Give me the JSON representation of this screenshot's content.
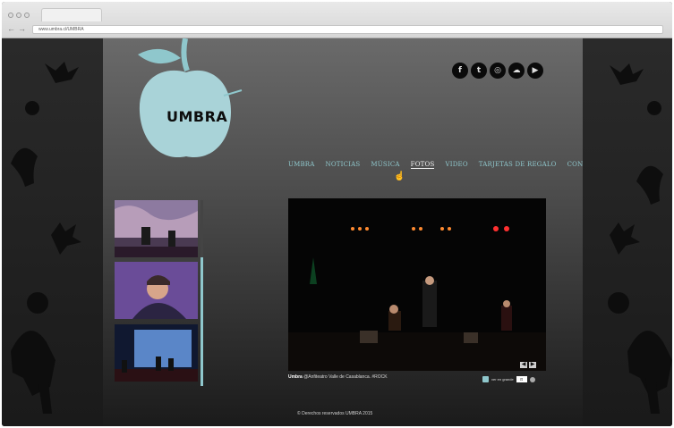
{
  "browser": {
    "url": "www.umbra.cl/UMBRA"
  },
  "site": {
    "logo_text": "UMBRA",
    "accent_color": "#8fc7cc",
    "social": [
      {
        "name": "facebook-icon",
        "glyph": "f"
      },
      {
        "name": "twitter-icon",
        "glyph": "t"
      },
      {
        "name": "instagram-icon",
        "glyph": "◎"
      },
      {
        "name": "soundcloud-icon",
        "glyph": "☁"
      },
      {
        "name": "youtube-icon",
        "glyph": "▶"
      }
    ],
    "menu": [
      {
        "label": "UMBRA",
        "active": false
      },
      {
        "label": "NOTICIAS",
        "active": false
      },
      {
        "label": "MÚSICA",
        "active": false
      },
      {
        "label": "FOTOS",
        "active": true
      },
      {
        "label": "VIDEO",
        "active": false
      },
      {
        "label": "TARJETAS DE REGALO",
        "active": false
      },
      {
        "label": "CONTACTO",
        "active": false
      }
    ]
  },
  "gallery": {
    "caption_title": "Umbra",
    "caption_text": "@Anfiteatro Valle de Casablanca. #ROCK",
    "controls_label": "ver en grande",
    "footer": "Derechos reservados UMBRA 2015"
  }
}
